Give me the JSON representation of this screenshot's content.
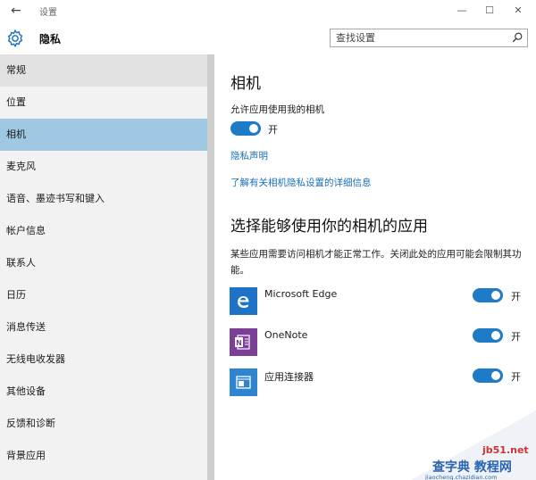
{
  "window": {
    "title": "设置",
    "back": "←",
    "minimize": "—",
    "maximize": "☐",
    "close": "✕"
  },
  "header": {
    "title": "隐私",
    "icon": "gear-icon"
  },
  "search": {
    "placeholder": "查找设置",
    "icon": "search-icon"
  },
  "sidebar": {
    "items": [
      {
        "label": "常规",
        "state": "hover"
      },
      {
        "label": "位置"
      },
      {
        "label": "相机",
        "state": "selected"
      },
      {
        "label": "麦克风"
      },
      {
        "label": "语音、墨迹书写和键入"
      },
      {
        "label": "帐户信息"
      },
      {
        "label": "联系人"
      },
      {
        "label": "日历"
      },
      {
        "label": "消息传送"
      },
      {
        "label": "无线电收发器"
      },
      {
        "label": "其他设备"
      },
      {
        "label": "反馈和诊断"
      },
      {
        "label": "背景应用"
      }
    ]
  },
  "main": {
    "title": "相机",
    "allow_label": "允许应用使用我的相机",
    "allow_toggle": {
      "on": true,
      "text": "开"
    },
    "privacy_link": "隐私声明",
    "details_link": "了解有关相机隐私设置的详细信息",
    "apps_title": "选择能够使用你的相机的应用",
    "apps_desc": "某些应用需要访问相机才能正常工作。关闭此处的应用可能会限制其功能。",
    "apps": [
      {
        "name": "Microsoft Edge",
        "toggle_text": "开",
        "on": true,
        "tile_color": "#1e73c6",
        "icon": "edge-icon"
      },
      {
        "name": "OneNote",
        "toggle_text": "开",
        "on": true,
        "tile_color": "#7c3f98",
        "icon": "onenote-icon"
      },
      {
        "name": "应用连接器",
        "toggle_text": "开",
        "on": true,
        "tile_color": "#2e84cf",
        "icon": "app-connector-icon"
      }
    ]
  },
  "colors": {
    "accent": "#1e7bc7",
    "selected": "#9fc9e3",
    "link": "#1a6fb6"
  },
  "watermark": {
    "site": "jb51.net",
    "text": "查字典 教程网",
    "url": "jiaocheng.chazidian.com"
  }
}
